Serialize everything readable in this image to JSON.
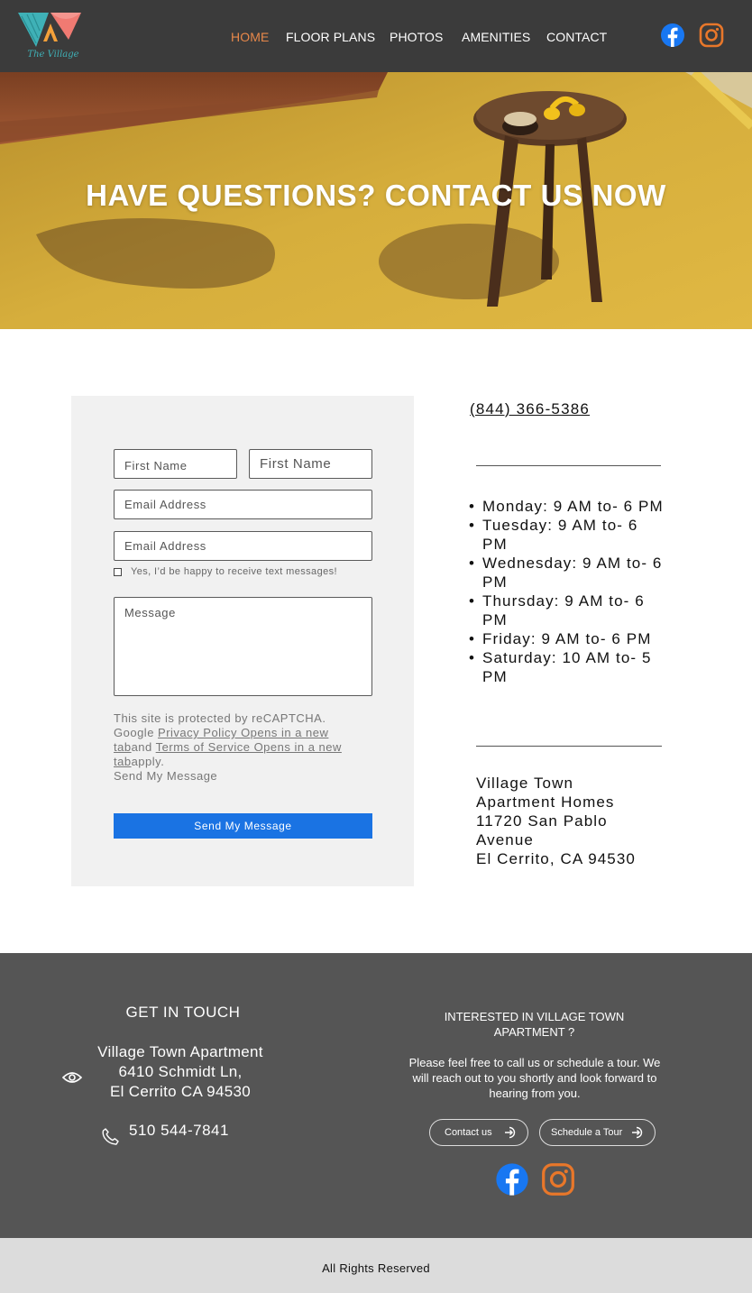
{
  "brand": {
    "logo_text": "The Village",
    "accent_color": "#e8884a",
    "logo_colors": [
      "#3fb1b7",
      "#f07a72",
      "#f4a13a"
    ]
  },
  "nav": {
    "items": [
      {
        "label": "HOME",
        "active": true
      },
      {
        "label": "FLOOR PLANS",
        "active": false
      },
      {
        "label": "PHOTOS",
        "active": false
      },
      {
        "label": "AMENITIES",
        "active": false
      },
      {
        "label": "CONTACT",
        "active": false
      }
    ]
  },
  "social": {
    "facebook_icon": "facebook-icon",
    "instagram_icon": "instagram-icon",
    "facebook_color": "#1877f2",
    "instagram_color": "#e8772a"
  },
  "hero": {
    "title": "HAVE QUESTIONS? CONTACT US NOW"
  },
  "form": {
    "first_name_placeholder": "First Name",
    "last_name_placeholder": "First Name",
    "email_placeholder": "Email Address",
    "email2_placeholder": "Email Address",
    "sms_label": "Yes, I’d be happy to receive text messages!",
    "message_placeholder": "Message",
    "recaptcha": {
      "prefix": "This site is protected by reCAPTCHA. Google ",
      "privacy_link": "Privacy Policy Opens in a new tab",
      "and": "and ",
      "terms_link": "Terms of Service Opens in a new tab",
      "suffix": "apply.",
      "send_text": "Send My Message"
    },
    "submit_label": "Send My Message",
    "submit_color": "#1a73e3"
  },
  "contact": {
    "phone": "(844) 366-5386",
    "hours": [
      "Monday: 9 AM to- 6 PM",
      "Tuesday: 9 AM to- 6 PM",
      "Wednesday: 9 AM to- 6 PM",
      "Thursday: 9 AM to- 6 PM",
      "Friday: 9 AM to- 6 PM",
      "Saturday: 10 AM to- 5 PM"
    ],
    "address_lines": [
      "Village Town Apartment Homes",
      "11720 San Pablo Avenue",
      "El Cerrito, CA 94530"
    ]
  },
  "footer": {
    "get_in_touch": "GET IN TOUCH",
    "address_lines": [
      "Village Town Apartment",
      "6410 Schmidt Ln,",
      "El Cerrito CA 94530"
    ],
    "phone": "510 544-7841",
    "interested_title": "INTERESTED IN VILLAGE TOWN APARTMENT ?",
    "interested_text": "Please feel free to call us or schedule a tour. We will reach out to you shortly and look forward to hearing from you.",
    "contact_button": "Contact us",
    "tour_button": "Schedule a Tour",
    "copyright": "All Rights Reserved"
  }
}
